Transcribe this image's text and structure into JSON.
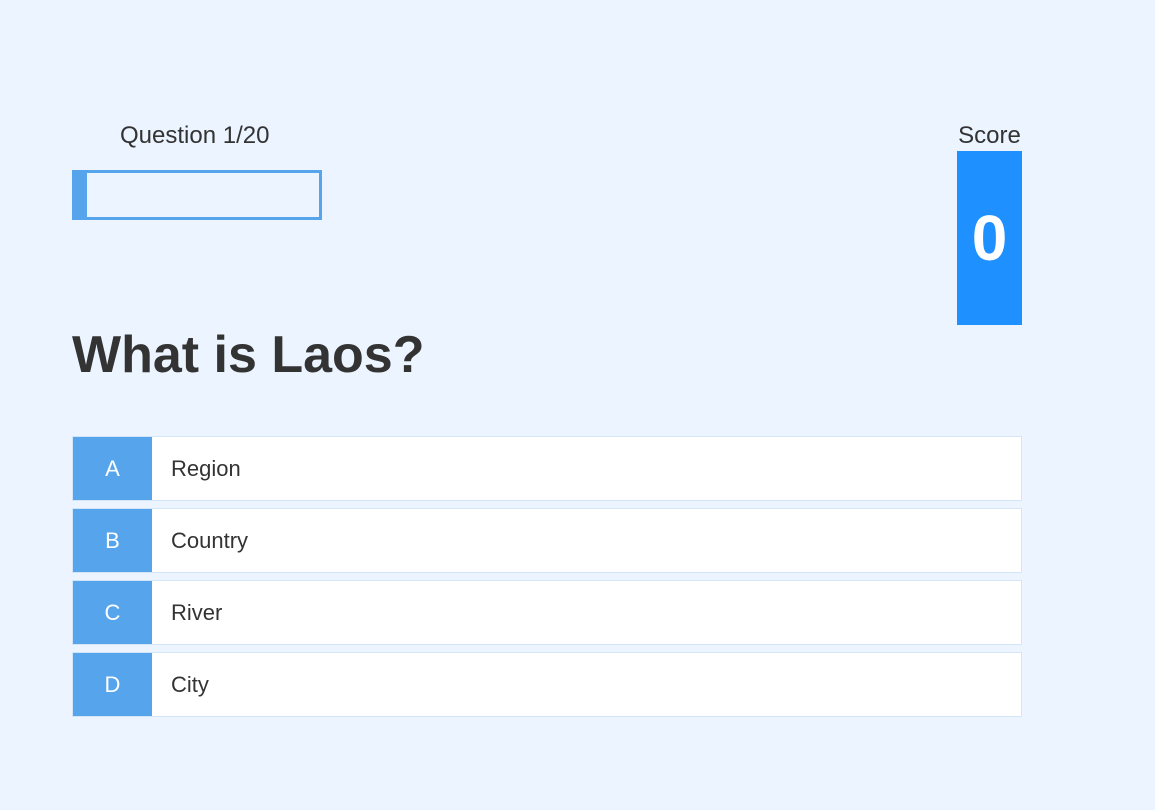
{
  "hud": {
    "question_counter": "Question 1/20",
    "progress_fraction": 0.05,
    "score_label": "Score",
    "score_value": "0"
  },
  "question": {
    "text": "What is Laos?"
  },
  "choices": [
    {
      "prefix": "A",
      "text": "Region"
    },
    {
      "prefix": "B",
      "text": "Country"
    },
    {
      "prefix": "C",
      "text": "River"
    },
    {
      "prefix": "D",
      "text": "City"
    }
  ],
  "colors": {
    "background": "#ebf4ff",
    "accent": "#56a5ec",
    "score_box": "#1e90ff",
    "text": "#333333"
  }
}
